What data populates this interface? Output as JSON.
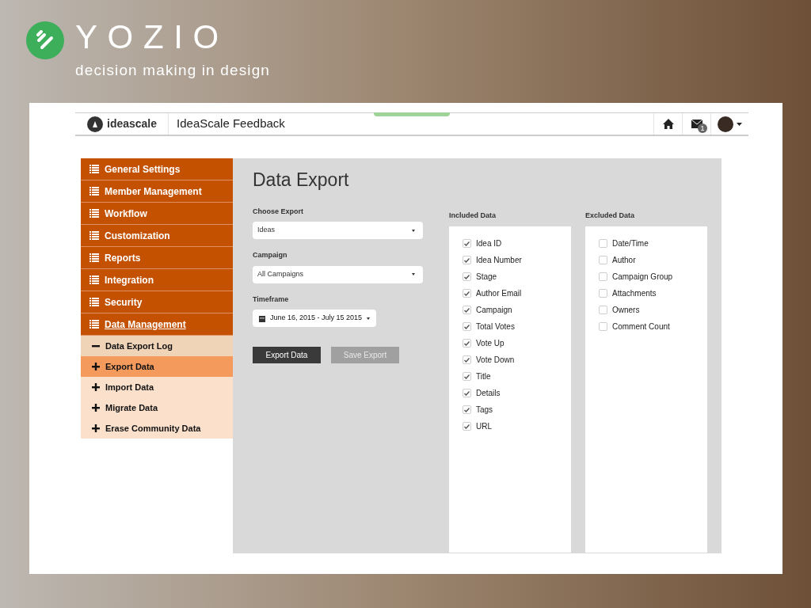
{
  "brand": {
    "name": "YOZIO",
    "tagline": "decision making in design"
  },
  "header": {
    "logo_text": "ideascale",
    "title": "IdeaScale Feedback",
    "notification_count": "1"
  },
  "sidebar": {
    "items": [
      {
        "label": "General Settings",
        "selected": false
      },
      {
        "label": "Member Management",
        "selected": false
      },
      {
        "label": "Workflow",
        "selected": false
      },
      {
        "label": "Customization",
        "selected": false
      },
      {
        "label": "Reports",
        "selected": false
      },
      {
        "label": "Integration",
        "selected": false
      },
      {
        "label": "Security",
        "selected": false
      },
      {
        "label": "Data Management",
        "selected": true
      }
    ],
    "subitems": [
      {
        "label": "Data Export Log",
        "expanded": true,
        "selected": false
      },
      {
        "label": "Export Data",
        "expanded": false,
        "selected": true
      },
      {
        "label": "Import Data",
        "expanded": false,
        "selected": false
      },
      {
        "label": "Migrate Data",
        "expanded": false,
        "selected": false
      },
      {
        "label": "Erase Community Data",
        "expanded": false,
        "selected": false
      }
    ]
  },
  "main": {
    "title": "Data Export",
    "fields": [
      {
        "kind": "select",
        "label": "Choose Export",
        "value": "Ideas"
      },
      {
        "kind": "select",
        "label": "Campaign",
        "value": "All Campaigns"
      },
      {
        "kind": "date",
        "label": "Timeframe",
        "value": "June 16, 2015 - July 15 2015"
      }
    ],
    "buttons": [
      {
        "label": "Export Data",
        "disabled": false
      },
      {
        "label": "Save Export",
        "disabled": true
      }
    ],
    "lists": [
      {
        "title": "Included Data",
        "items": [
          {
            "label": "Idea ID",
            "checked": true
          },
          {
            "label": "Idea Number",
            "checked": true
          },
          {
            "label": "Stage",
            "checked": true
          },
          {
            "label": "Author Email",
            "checked": true
          },
          {
            "label": "Campaign",
            "checked": true
          },
          {
            "label": "Total Votes",
            "checked": true
          },
          {
            "label": "Vote Up",
            "checked": true
          },
          {
            "label": "Vote Down",
            "checked": true
          },
          {
            "label": "Title",
            "checked": true
          },
          {
            "label": "Details",
            "checked": true
          },
          {
            "label": "Tags",
            "checked": true
          },
          {
            "label": "URL",
            "checked": true
          }
        ]
      },
      {
        "title": "Excluded Data",
        "items": [
          {
            "label": "Date/Time",
            "checked": false
          },
          {
            "label": "Author",
            "checked": false
          },
          {
            "label": "Campaign Group",
            "checked": false
          },
          {
            "label": "Attachments",
            "checked": false
          },
          {
            "label": "Owners",
            "checked": false
          },
          {
            "label": "Comment Count",
            "checked": false
          }
        ]
      }
    ]
  }
}
